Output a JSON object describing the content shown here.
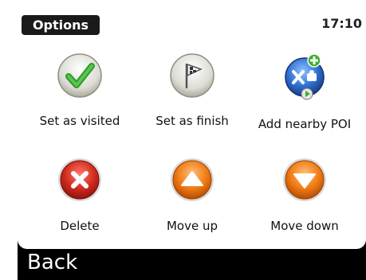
{
  "header": {
    "title": "Options",
    "clock": "17:10"
  },
  "items": [
    {
      "label": "Set as visited",
      "icon": "checkmark-icon"
    },
    {
      "label": "Set as finish",
      "icon": "finish-flag-icon"
    },
    {
      "label": "Add nearby POI",
      "icon": "add-poi-icon"
    },
    {
      "label": "Delete",
      "icon": "delete-icon"
    },
    {
      "label": "Move up",
      "icon": "arrow-up-icon"
    },
    {
      "label": "Move down",
      "icon": "arrow-down-icon"
    }
  ],
  "footer": {
    "back_label": "Back"
  },
  "colors": {
    "green": "#3aa82f",
    "red": "#c81e1e",
    "orange": "#f07a12",
    "blue": "#2f6fd0"
  }
}
